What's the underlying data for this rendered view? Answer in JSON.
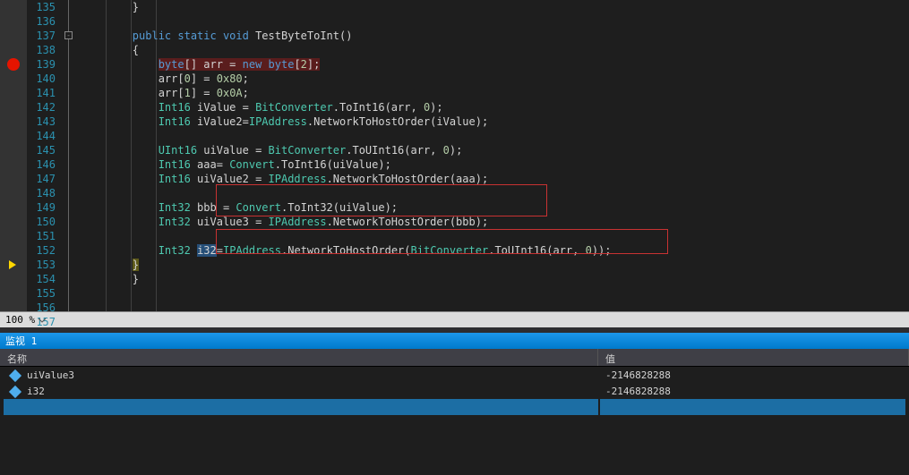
{
  "lines": [
    135,
    136,
    137,
    138,
    139,
    140,
    141,
    142,
    143,
    144,
    145,
    146,
    147,
    148,
    149,
    150,
    151,
    152,
    153,
    154,
    155,
    156,
    157
  ],
  "code": {
    "l135": {
      "brace": "}"
    },
    "l137": {
      "mods": "public static void",
      "name": "TestByteToInt",
      "sig": "()"
    },
    "l138": {
      "brace": "{"
    },
    "l139": {
      "t1": "byte",
      "t2": "[] arr = ",
      "t3": "new byte",
      "t4": "[",
      "n": "2",
      "t5": "];"
    },
    "l140": {
      "txt": "arr[",
      "n1": "0",
      "t2": "] = ",
      "n2": "0x80",
      "t3": ";"
    },
    "l141": {
      "txt": "arr[",
      "n1": "1",
      "t2": "] = ",
      "n2": "0x0A",
      "t3": ";"
    },
    "l142": {
      "t": "Int16",
      "txt": " iValue = ",
      "c": "BitConverter",
      "m": ".ToInt16(arr, ",
      "n": "0",
      "e": ");"
    },
    "l143": {
      "t": "Int16",
      "txt": " iValue2=",
      "c": "IPAddress",
      "m": ".NetworkToHostOrder(iValue);"
    },
    "l145": {
      "t": "UInt16",
      "txt": " uiValue = ",
      "c": "BitConverter",
      "m": ".ToUInt16(arr, ",
      "n": "0",
      "e": ");"
    },
    "l146": {
      "t": "Int16",
      "txt": " aaa= ",
      "c": "Convert",
      "m": ".ToInt16(uiValue);"
    },
    "l147": {
      "t": "Int16",
      "txt": " uiValue2 = ",
      "c": "IPAddress",
      "m": ".NetworkToHostOrder(aaa);"
    },
    "l149": {
      "t": "Int32",
      "txt": " bbb = ",
      "c": "Convert",
      "m": ".ToInt32(uiValue);"
    },
    "l150": {
      "t": "Int32",
      "txt": " uiValue3 = ",
      "c": "IPAddress",
      "m": ".NetworkToHostOrder(bbb);"
    },
    "l152": {
      "t": "Int32",
      "sp": " ",
      "v": "i32",
      "eq": "=",
      "c": "IPAddress",
      "m1": ".NetworkToHostOrder(",
      "c2": "BitConverter",
      "m2": ".ToUInt16(arr, ",
      "n": "0",
      "e": "));"
    },
    "l153": {
      "brace": "}"
    },
    "l154": {
      "brace": "}"
    }
  },
  "zoom": {
    "value": "100 %"
  },
  "watch": {
    "tab": "监视 1",
    "nameHeader": "名称",
    "valueHeader": "值",
    "rows": [
      {
        "name": "uiValue3",
        "value": "-2146828288"
      },
      {
        "name": "i32",
        "value": "-2146828288"
      }
    ]
  }
}
